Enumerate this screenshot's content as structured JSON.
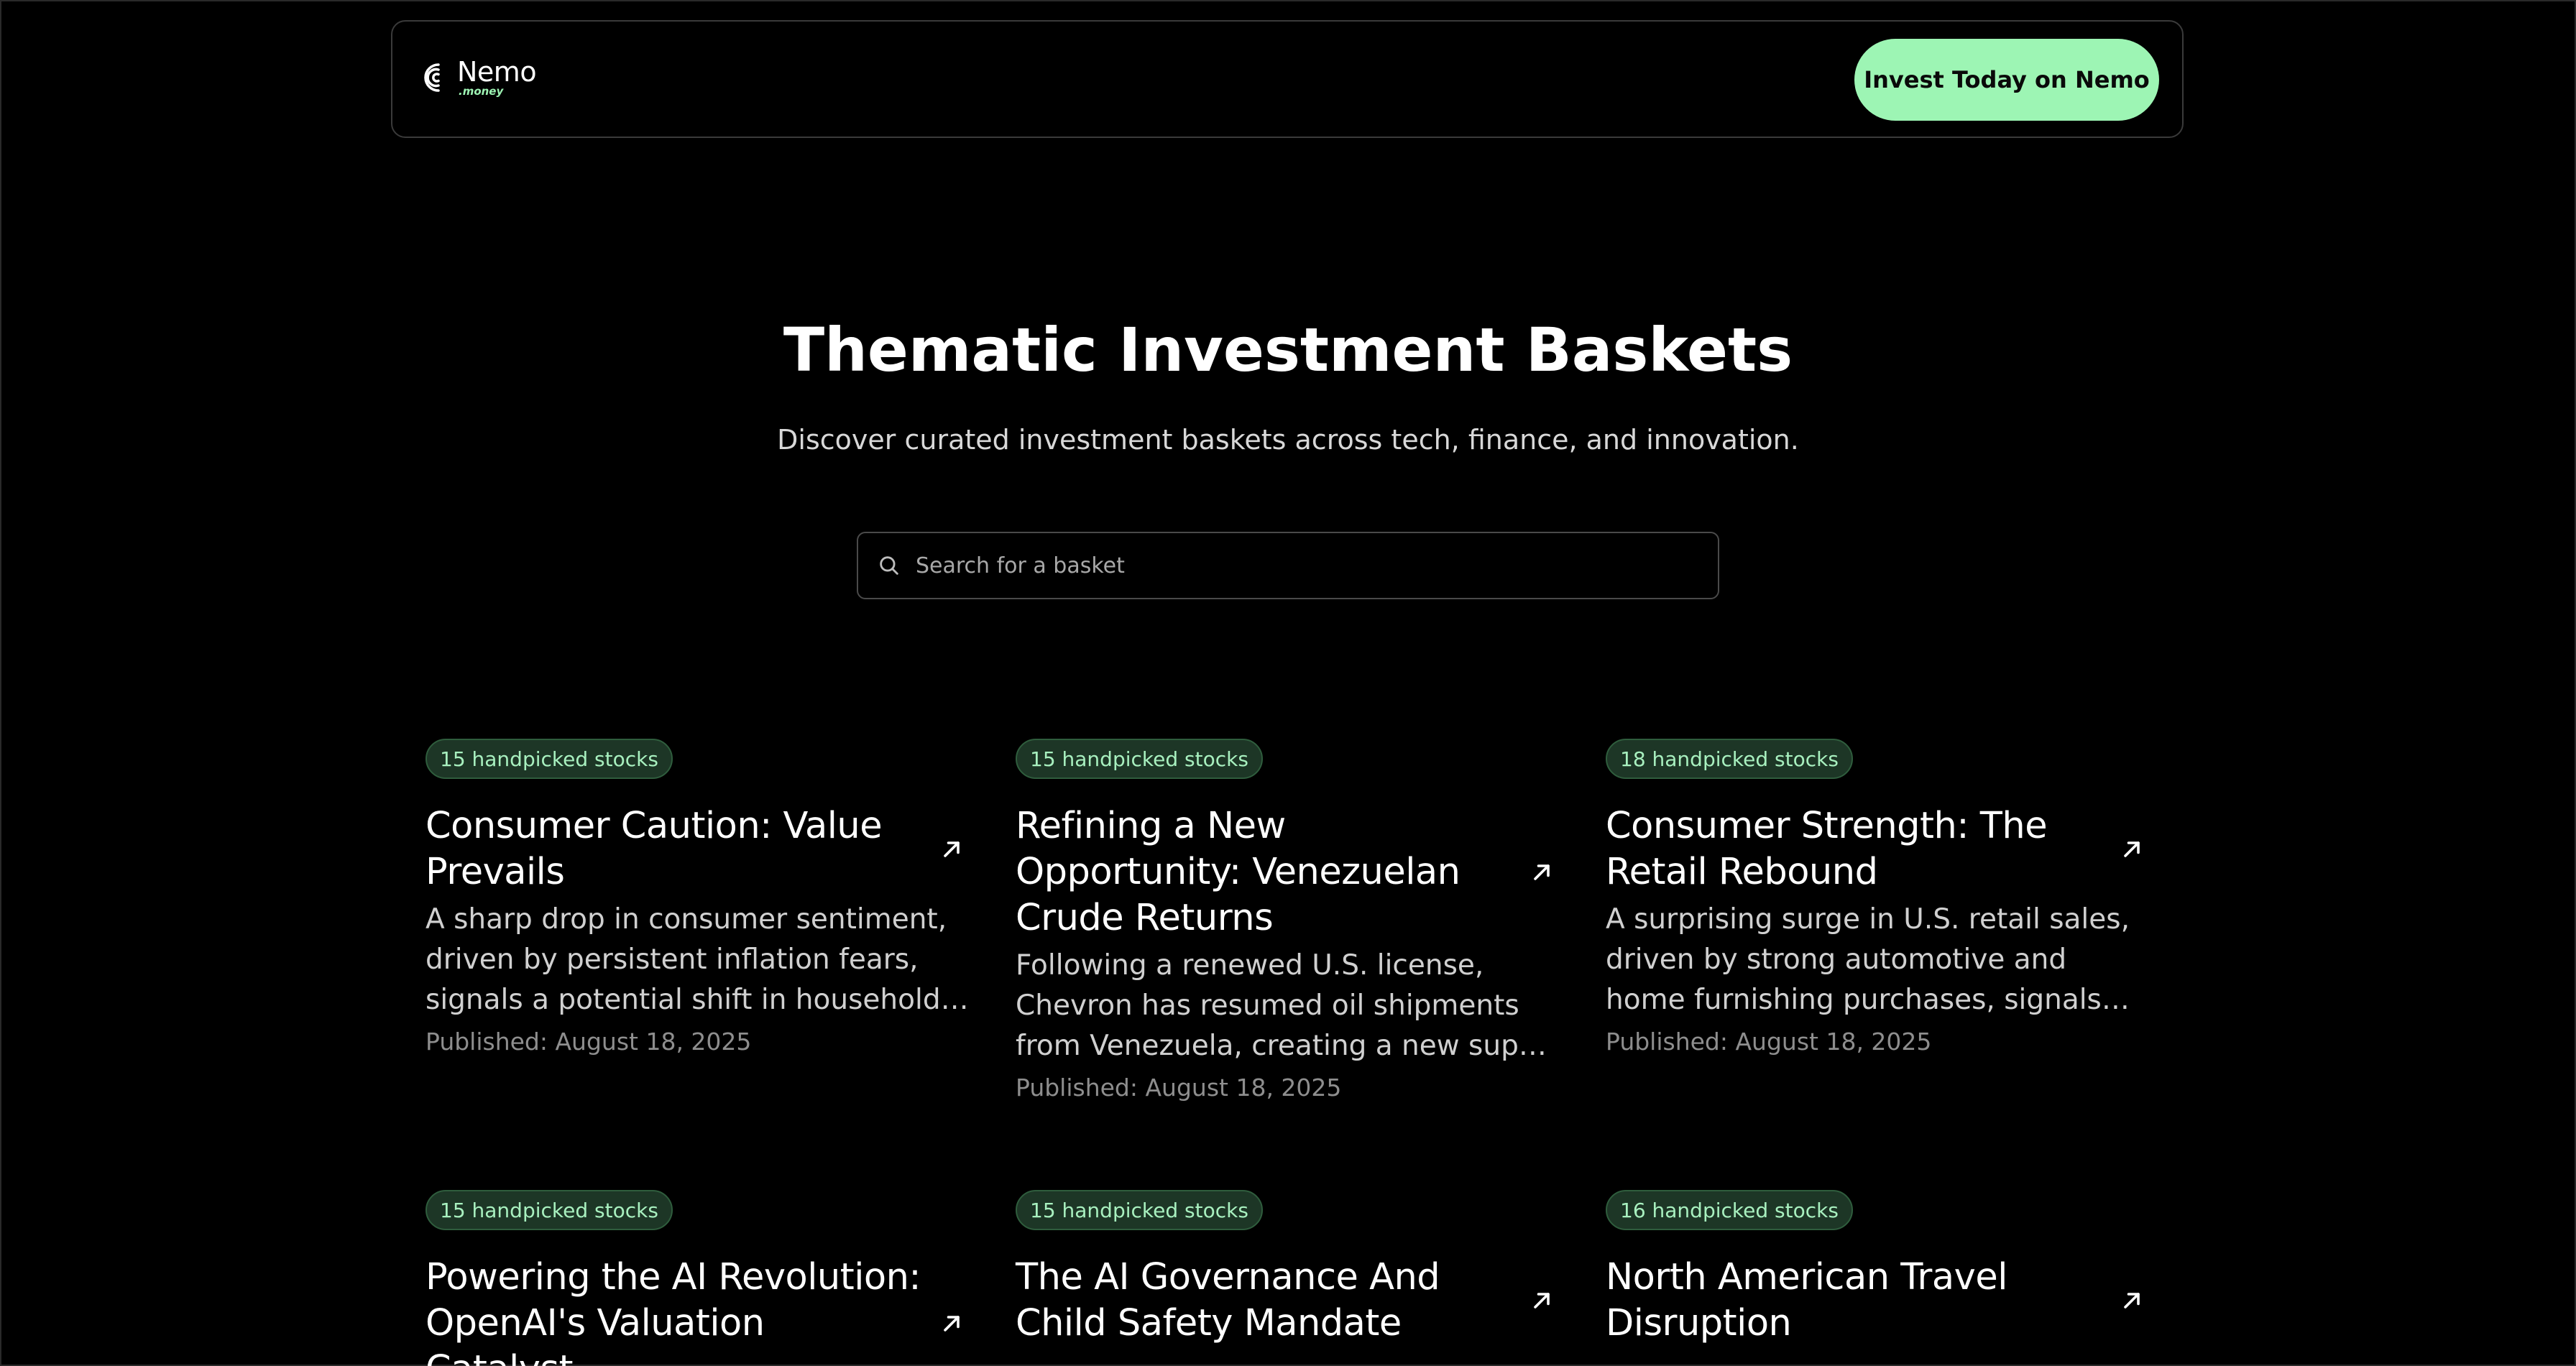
{
  "header": {
    "logo_name": "Nemo",
    "logo_sub": ".money",
    "cta_label": "Invest Today on Nemo"
  },
  "hero": {
    "title": "Thematic Investment Baskets",
    "subtitle": "Discover curated investment baskets across tech, finance, and innovation."
  },
  "search": {
    "placeholder": "Search for a basket",
    "value": ""
  },
  "colors": {
    "background": "#000000",
    "accent": "#9df5b4",
    "badge_bg": "#1d3626",
    "badge_text": "#a8f0bf"
  },
  "cards": [
    {
      "badge": "15 handpicked stocks",
      "title": "Consumer Caution: Value Prevails",
      "description": "A sharp drop in consumer sentiment, driven by persistent inflation fears, signals a potential shift in household spending.",
      "published": "Published: August 18, 2025",
      "icon": "arrow-up-right-icon"
    },
    {
      "badge": "15 handpicked stocks",
      "title": "Refining a New Opportunity: Venezuelan Crude Returns",
      "description": "Following a renewed U.S. license, Chevron has resumed oil shipments from Venezuela, creating a new supply of",
      "published": "Published: August 18, 2025",
      "icon": "arrow-up-right-icon"
    },
    {
      "badge": "18 handpicked stocks",
      "title": "Consumer Strength: The Retail Rebound",
      "description": "A surprising surge in U.S. retail sales, driven by strong automotive and home furnishing purchases, signals continued",
      "published": "Published: August 18, 2025",
      "icon": "arrow-up-right-icon"
    },
    {
      "badge": "15 handpicked stocks",
      "title": "Powering the AI Revolution: OpenAI's Valuation Catalyst",
      "description": "",
      "published": "",
      "icon": "arrow-up-right-icon"
    },
    {
      "badge": "15 handpicked stocks",
      "title": "The AI Governance And Child Safety Mandate",
      "description": "",
      "published": "",
      "icon": "arrow-up-right-icon"
    },
    {
      "badge": "16 handpicked stocks",
      "title": "North American Travel Disruption",
      "description": "",
      "published": "",
      "icon": "arrow-up-right-icon"
    }
  ]
}
